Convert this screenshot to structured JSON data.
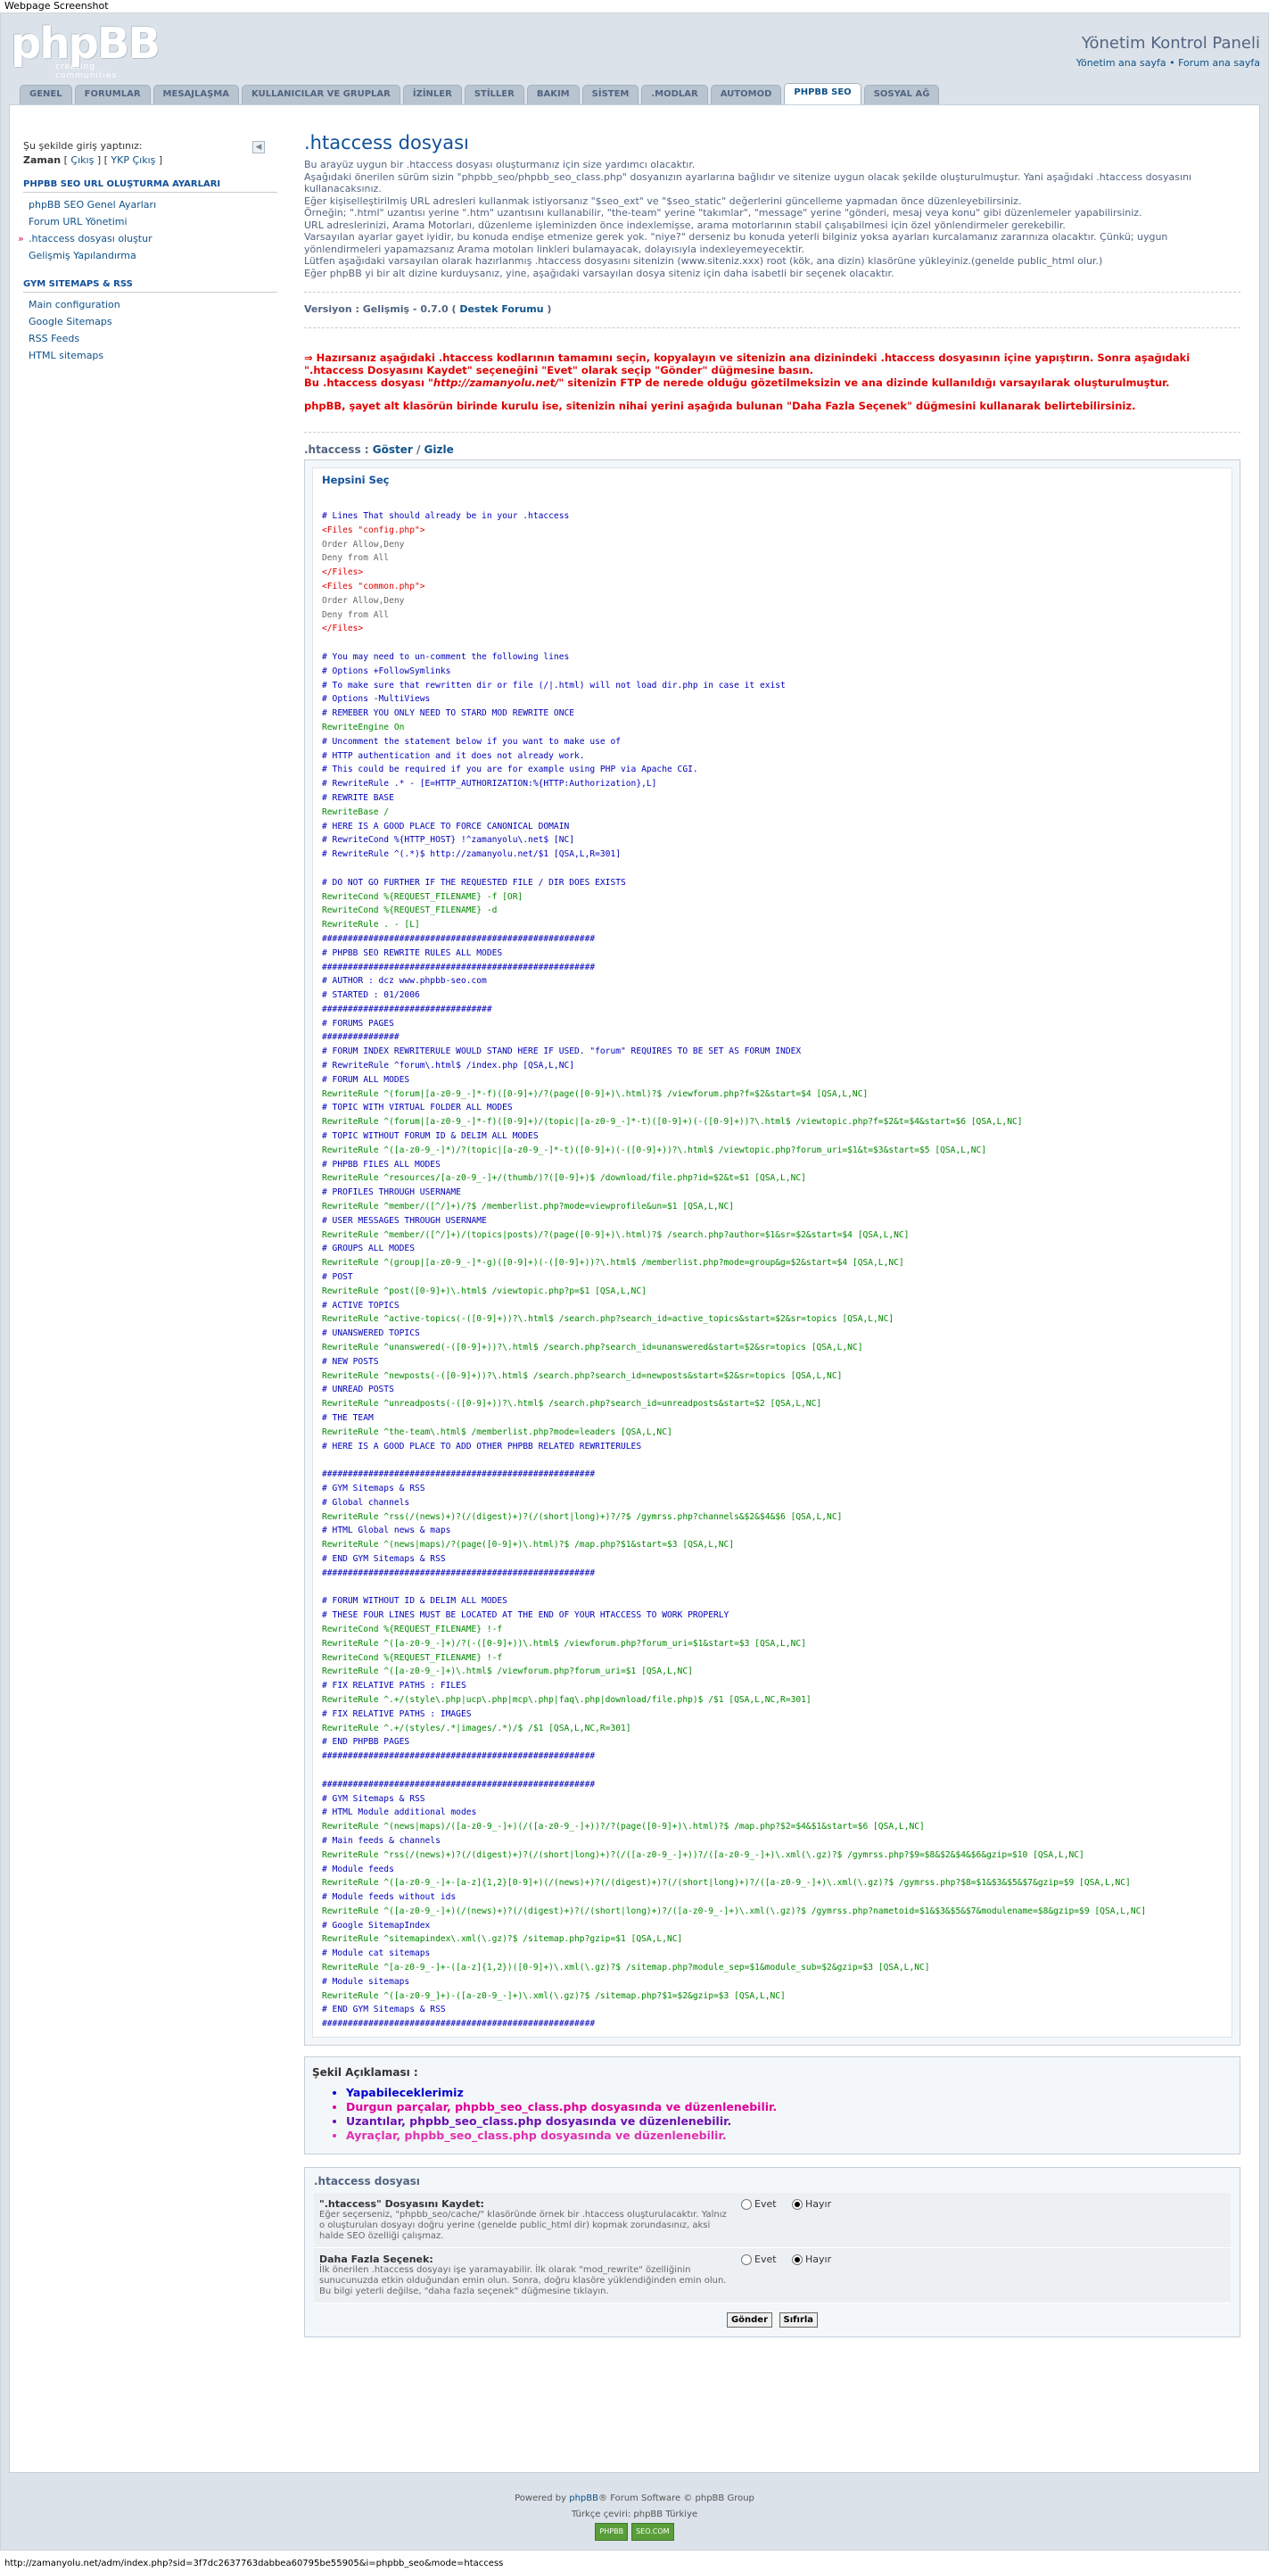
{
  "screenshot_label": "Webpage Screenshot",
  "header": {
    "logo": "phpBB",
    "tagline": "creating communities",
    "title": "Yönetim Kontrol Paneli",
    "link_home": "Yönetim ana sayfa",
    "sep": "•",
    "link_forum": "Forum ana sayfa"
  },
  "tabs": [
    "GENEL",
    "FORUMLAR",
    "MESAJLAŞMA",
    "KULLANICILAR VE GRUPLAR",
    "İZİNLER",
    "STİLLER",
    "BAKIM",
    "SİSTEM",
    ".MODLAR",
    "AUTOMOD",
    "PHPBB SEO",
    "SOSYAL AĞ"
  ],
  "active_tab": 10,
  "sidebar": {
    "login_prefix": "Şu şekilde giriş yaptınız:",
    "user": "Zaman",
    "logout": "Çıkış",
    "acp_logout": "YKP Çıkış",
    "collapse_icon": "double-left-arrow",
    "group1_title": "PHPBB SEO URL OLUŞTURMA AYARLARI",
    "group1_items": [
      "phpBB SEO Genel Ayarları",
      "Forum URL Yönetimi",
      ".htaccess dosyası oluştur",
      "Gelişmiş Yapılandırma"
    ],
    "group1_active": 2,
    "group2_title": "GYM SITEMAPS & RSS",
    "group2_items": [
      "Main configuration",
      "Google Sitemaps",
      "RSS Feeds",
      "HTML sitemaps"
    ]
  },
  "main": {
    "title": ".htaccess dosyası",
    "intro": [
      "Bu arayüz uygun bir .htaccess dosyası oluşturmanız için size yardımcı olacaktır.",
      "Aşağıdaki önerilen sürüm sizin \"phpbb_seo/phpbb_seo_class.php\" dosyanızın ayarlarına bağlıdır ve sitenize uygun olacak şekilde oluşturulmuştur. Yani aşağıdaki .htaccess dosyasını kullanacaksınız.",
      "Eğer kişiselleştirilmiş URL adresleri kullanmak istiyorsanız \"$seo_ext\" ve \"$seo_static\" değerlerini güncelleme yapmadan önce düzenleyebilirsiniz.",
      "Örneğin; \".html\" uzantısı yerine \".htm\" uzantısını kullanabilir, \"the-team\" yerine \"takımlar\", \"message\" yerine \"gönderi, mesaj veya konu\" gibi düzenlemeler yapabilirsiniz.",
      "URL adreslerinizi, Arama Motorları, düzenleme işleminizden önce indexlemişse, arama motorlarının stabil çalışabilmesi için özel yönlendirmeler gerekebilir.",
      "Varsayılan ayarlar gayet iyidir, bu konuda endişe etmenize gerek yok. \"niye?\" derseniz bu konuda yeterli bilginiz yoksa ayarları kurcalamanız zararınıza olacaktır. Çünkü; uygun yönlendirmeleri yapamazsanız Arama motoları linkleri bulamayacak, dolayısıyla indexleyemeyecektir.",
      "Lütfen aşağıdaki varsayılan olarak hazırlanmış .htaccess dosyasını sitenizin (www.siteniz.xxx) root (kök, ana dizin) klasörüne yükleyiniz.(genelde public_html olur.)",
      "Eğer phpBB yi bir alt dizine kurduysanız, yine, aşağıdaki varsayılan dosya siteniz için daha isabetli bir seçenek olacaktır."
    ],
    "version_label": "Versiyon : Gelişmiş - 0.7.0 (",
    "version_link": "Destek Forumu",
    "version_end": ")",
    "warn1": "⇒ Hazırsanız aşağıdaki .htaccess kodlarının tamamını seçin, kopyalayın ve sitenizin ana dizinindeki .htaccess dosyasının içine yapıştırın. Sonra aşağıdaki \".htaccess Dosyasını Kaydet\" seçeneğini \"Evet\" olarak seçip \"Gönder\" düğmesine basın.",
    "warn2_a": "Bu .htaccess dosyası \"",
    "warn2_url": "http://zamanyolu.net/",
    "warn2_b": "\" sitenizin FTP de nerede olduğu gözetilmeksizin ve ana dizinde kullanıldığı varsayılarak oluşturulmuştur.",
    "warn3": "phpBB, şayet alt klasörün birinde kurulu ise, sitenizin nihai yerini aşağıda bulunan \"Daha Fazla Seçenek\" düğmesini kullanarak belirtebilirsiniz.",
    "ht_label": ".htaccess :",
    "ht_show": "Göster",
    "ht_slash": "/",
    "ht_hide": "Gizle",
    "select_all": "Hepsini Seç",
    "code_lines": [
      [
        "c",
        "# Lines That should already be in your .htaccess"
      ],
      [
        "t",
        "<Files \"config.php\">"
      ],
      [
        "g",
        "Order Allow,Deny"
      ],
      [
        "g",
        "Deny from All"
      ],
      [
        "t",
        "</Files>"
      ],
      [
        "t",
        "<Files \"common.php\">"
      ],
      [
        "g",
        "Order Allow,Deny"
      ],
      [
        "g",
        "Deny from All"
      ],
      [
        "t",
        "</Files>"
      ],
      [
        "b",
        ""
      ],
      [
        "c",
        "# You may need to un-comment the following lines"
      ],
      [
        "c",
        "# Options +FollowSymlinks"
      ],
      [
        "c",
        "# To make sure that rewritten dir or file (/|.html) will not load dir.php in case it exist"
      ],
      [
        "c",
        "# Options -MultiViews"
      ],
      [
        "c",
        "# REMEBER YOU ONLY NEED TO STARD MOD REWRITE ONCE"
      ],
      [
        "k",
        "RewriteEngine On"
      ],
      [
        "c",
        "# Uncomment the statement below if you want to make use of"
      ],
      [
        "c",
        "# HTTP authentication and it does not already work."
      ],
      [
        "c",
        "# This could be required if you are for example using PHP via Apache CGI."
      ],
      [
        "c",
        "# RewriteRule .* - [E=HTTP_AUTHORIZATION:%{HTTP:Authorization},L]"
      ],
      [
        "c",
        "# REWRITE BASE"
      ],
      [
        "k",
        "RewriteBase /"
      ],
      [
        "c",
        "# HERE IS A GOOD PLACE TO FORCE CANONICAL DOMAIN"
      ],
      [
        "c",
        "# RewriteCond %{HTTP_HOST} !^zamanyolu\\.net$ [NC]"
      ],
      [
        "c",
        "# RewriteRule ^(.*)$ http://zamanyolu.net/$1 [QSA,L,R=301]"
      ],
      [
        "b",
        ""
      ],
      [
        "c",
        "# DO NOT GO FURTHER IF THE REQUESTED FILE / DIR DOES EXISTS"
      ],
      [
        "k",
        "RewriteCond %{REQUEST_FILENAME} -f [OR]"
      ],
      [
        "k",
        "RewriteCond %{REQUEST_FILENAME} -d"
      ],
      [
        "k",
        "RewriteRule . - [L]"
      ],
      [
        "c",
        "#####################################################"
      ],
      [
        "c",
        "# PHPBB SEO REWRITE RULES ALL MODES"
      ],
      [
        "c",
        "#####################################################"
      ],
      [
        "c",
        "# AUTHOR : dcz www.phpbb-seo.com"
      ],
      [
        "c",
        "# STARTED : 01/2006"
      ],
      [
        "c",
        "#################################"
      ],
      [
        "c",
        "# FORUMS PAGES"
      ],
      [
        "c",
        "###############"
      ],
      [
        "c",
        "# FORUM INDEX REWRITERULE WOULD STAND HERE IF USED. \"forum\" REQUIRES TO BE SET AS FORUM INDEX"
      ],
      [
        "c",
        "# RewriteRule ^forum\\.html$ /index.php [QSA,L,NC]"
      ],
      [
        "c",
        "# FORUM ALL MODES"
      ],
      [
        "k",
        "RewriteRule ^(forum|[a-z0-9_-]*-f)([0-9]+)/?(page([0-9]+)\\.html)?$ /viewforum.php?f=$2&start=$4 [QSA,L,NC]"
      ],
      [
        "c",
        "# TOPIC WITH VIRTUAL FOLDER ALL MODES"
      ],
      [
        "k",
        "RewriteRule ^(forum|[a-z0-9_-]*-f)([0-9]+)/(topic|[a-z0-9_-]*-t)([0-9]+)(-([0-9]+))?\\.html$ /viewtopic.php?f=$2&t=$4&start=$6 [QSA,L,NC]"
      ],
      [
        "c",
        "# TOPIC WITHOUT FORUM ID & DELIM ALL MODES"
      ],
      [
        "k",
        "RewriteRule ^([a-z0-9_-]*)/?(topic|[a-z0-9_-]*-t)([0-9]+)(-([0-9]+))?\\.html$ /viewtopic.php?forum_uri=$1&t=$3&start=$5 [QSA,L,NC]"
      ],
      [
        "c",
        "# PHPBB FILES ALL MODES"
      ],
      [
        "k",
        "RewriteRule ^resources/[a-z0-9_-]+/(thumb/)?([0-9]+)$ /download/file.php?id=$2&t=$1 [QSA,L,NC]"
      ],
      [
        "c",
        "# PROFILES THROUGH USERNAME"
      ],
      [
        "k",
        "RewriteRule ^member/([^/]+)/?$ /memberlist.php?mode=viewprofile&un=$1 [QSA,L,NC]"
      ],
      [
        "c",
        "# USER MESSAGES THROUGH USERNAME"
      ],
      [
        "k",
        "RewriteRule ^member/([^/]+)/(topics|posts)/?(page([0-9]+)\\.html)?$ /search.php?author=$1&sr=$2&start=$4 [QSA,L,NC]"
      ],
      [
        "c",
        "# GROUPS ALL MODES"
      ],
      [
        "k",
        "RewriteRule ^(group|[a-z0-9_-]*-g)([0-9]+)(-([0-9]+))?\\.html$ /memberlist.php?mode=group&g=$2&start=$4 [QSA,L,NC]"
      ],
      [
        "c",
        "# POST"
      ],
      [
        "k",
        "RewriteRule ^post([0-9]+)\\.html$ /viewtopic.php?p=$1 [QSA,L,NC]"
      ],
      [
        "c",
        "# ACTIVE TOPICS"
      ],
      [
        "k",
        "RewriteRule ^active-topics(-([0-9]+))?\\.html$ /search.php?search_id=active_topics&start=$2&sr=topics [QSA,L,NC]"
      ],
      [
        "c",
        "# UNANSWERED TOPICS"
      ],
      [
        "k",
        "RewriteRule ^unanswered(-([0-9]+))?\\.html$ /search.php?search_id=unanswered&start=$2&sr=topics [QSA,L,NC]"
      ],
      [
        "c",
        "# NEW POSTS"
      ],
      [
        "k",
        "RewriteRule ^newposts(-([0-9]+))?\\.html$ /search.php?search_id=newposts&start=$2&sr=topics [QSA,L,NC]"
      ],
      [
        "c",
        "# UNREAD POSTS"
      ],
      [
        "k",
        "RewriteRule ^unreadposts(-([0-9]+))?\\.html$ /search.php?search_id=unreadposts&start=$2 [QSA,L,NC]"
      ],
      [
        "c",
        "# THE TEAM"
      ],
      [
        "k",
        "RewriteRule ^the-team\\.html$ /memberlist.php?mode=leaders [QSA,L,NC]"
      ],
      [
        "c",
        "# HERE IS A GOOD PLACE TO ADD OTHER PHPBB RELATED REWRITERULES"
      ],
      [
        "b",
        ""
      ],
      [
        "c",
        "#####################################################"
      ],
      [
        "c",
        "# GYM Sitemaps & RSS"
      ],
      [
        "c",
        "# Global channels"
      ],
      [
        "k",
        "RewriteRule ^rss(/(news)+)?(/(digest)+)?(/(short|long)+)?/?$ /gymrss.php?channels&$2&$4&$6 [QSA,L,NC]"
      ],
      [
        "c",
        "# HTML Global news & maps"
      ],
      [
        "k",
        "RewriteRule ^(news|maps)/?(page([0-9]+)\\.html)?$ /map.php?$1&start=$3 [QSA,L,NC]"
      ],
      [
        "c",
        "# END GYM Sitemaps & RSS"
      ],
      [
        "c",
        "#####################################################"
      ],
      [
        "b",
        ""
      ],
      [
        "c",
        "# FORUM WITHOUT ID & DELIM ALL MODES"
      ],
      [
        "c",
        "# THESE FOUR LINES MUST BE LOCATED AT THE END OF YOUR HTACCESS TO WORK PROPERLY"
      ],
      [
        "k",
        "RewriteCond %{REQUEST_FILENAME} !-f"
      ],
      [
        "k",
        "RewriteRule ^([a-z0-9_-]+)/?(-([0-9]+))\\.html$ /viewforum.php?forum_uri=$1&start=$3 [QSA,L,NC]"
      ],
      [
        "k",
        "RewriteCond %{REQUEST_FILENAME} !-f"
      ],
      [
        "k",
        "RewriteRule ^([a-z0-9_-]+)\\.html$ /viewforum.php?forum_uri=$1 [QSA,L,NC]"
      ],
      [
        "c",
        "# FIX RELATIVE PATHS : FILES"
      ],
      [
        "k",
        "RewriteRule ^.+/(style\\.php|ucp\\.php|mcp\\.php|faq\\.php|download/file.php)$ /$1 [QSA,L,NC,R=301]"
      ],
      [
        "c",
        "# FIX RELATIVE PATHS : IMAGES"
      ],
      [
        "k",
        "RewriteRule ^.+/(styles/.*|images/.*)/$ /$1 [QSA,L,NC,R=301]"
      ],
      [
        "c",
        "# END PHPBB PAGES"
      ],
      [
        "c",
        "#####################################################"
      ],
      [
        "b",
        ""
      ],
      [
        "c",
        "#####################################################"
      ],
      [
        "c",
        "# GYM Sitemaps & RSS"
      ],
      [
        "c",
        "# HTML Module additional modes"
      ],
      [
        "k",
        "RewriteRule ^(news|maps)/([a-z0-9_-]+)(/([a-z0-9_-]+))?/?(page([0-9]+)\\.html)?$ /map.php?$2=$4&$1&start=$6 [QSA,L,NC]"
      ],
      [
        "c",
        "# Main feeds & channels"
      ],
      [
        "k",
        "RewriteRule ^rss(/(news)+)?(/(digest)+)?(/(short|long)+)?(/([a-z0-9_-]+))?/([a-z0-9_-]+)\\.xml(\\.gz)?$ /gymrss.php?$9=$8&$2&$4&$6&gzip=$10 [QSA,L,NC]"
      ],
      [
        "c",
        "# Module feeds"
      ],
      [
        "k",
        "RewriteRule ^([a-z0-9_-]+-[a-z]{1,2}[0-9]+)(/(news)+)?(/(digest)+)?(/(short|long)+)?/([a-z0-9_-]+)\\.xml(\\.gz)?$ /gymrss.php?$8=$1&$3&$5&$7&gzip=$9 [QSA,L,NC]"
      ],
      [
        "c",
        "# Module feeds without ids"
      ],
      [
        "k",
        "RewriteRule ^([a-z0-9_-]+)(/(news)+)?(/(digest)+)?(/(short|long)+)?/([a-z0-9_-]+)\\.xml(\\.gz)?$ /gymrss.php?nametoid=$1&$3&$5&$7&modulename=$8&gzip=$9 [QSA,L,NC]"
      ],
      [
        "c",
        "# Google SitemapIndex"
      ],
      [
        "k",
        "RewriteRule ^sitemapindex\\.xml(\\.gz)?$ /sitemap.php?gzip=$1 [QSA,L,NC]"
      ],
      [
        "c",
        "# Module cat sitemaps"
      ],
      [
        "k",
        "RewriteRule ^[a-z0-9_-]+-([a-z]{1,2})([0-9]+)\\.xml(\\.gz)?$ /sitemap.php?module_sep=$1&module_sub=$2&gzip=$3 [QSA,L,NC]"
      ],
      [
        "c",
        "# Module sitemaps"
      ],
      [
        "k",
        "RewriteRule ^([a-z0-9_]+)-([a-z0-9_-]+)\\.xml(\\.gz)?$ /sitemap.php?$1=$2&gzip=$3 [QSA,L,NC]"
      ],
      [
        "c",
        "# END GYM Sitemaps & RSS"
      ],
      [
        "c",
        "#####################################################"
      ]
    ],
    "legend_title": "Şekil Açıklaması :",
    "legend_items": [
      {
        "text": "Yapabileceklerimiz",
        "color": "#0000cc"
      },
      {
        "text": "Durgun parçalar, phpbb_seo_class.php dosyasında ve düzenlenebilir.",
        "color": "#e0009a"
      },
      {
        "text": "Uzantılar, phpbb_seo_class.php dosyasında ve düzenlenebilir.",
        "color": "#6a0fb0"
      },
      {
        "text": "Ayraçlar, phpbb_seo_class.php dosyasında ve düzenlenebilir.",
        "color": "#e030b0"
      }
    ],
    "form_title": ".htaccess dosyası",
    "opt1_title": "\".htaccess\" Dosyasını Kaydet:",
    "opt1_desc": "Eğer seçerseniz, \"phpbb_seo/cache/\" klasöründe örnek bir .htaccess oluşturulacaktır. Yalnız o oluşturulan dosyayı doğru yerine (genelde public_html dir) kopmak zorundasınız, aksi halde SEO özelliği çalışmaz.",
    "opt2_title": "Daha Fazla Seçenek:",
    "opt2_desc": "İlk önerilen .htaccess dosyayı işe yaramayabilir. İlk olarak \"mod_rewrite\" özelliğinin sunucunuzda etkin olduğundan emin olun. Sonra, doğru klasöre yüklendiğinden emin olun. Bu bilgi yeterli değilse, \"daha fazla seçenek\" düğmesine tıklayın.",
    "yes": "Evet",
    "no": "Hayır",
    "submit": "Gönder",
    "reset": "Sıfırla"
  },
  "footer": {
    "powered_a": "Powered by",
    "powered_link": "phpBB",
    "powered_b": "® Forum Software © phpBB Group",
    "translation": "Türkçe çeviri: phpBB Türkiye",
    "badge1": "PHPBB",
    "badge2": "SEO.COM"
  },
  "status_url": "http://zamanyolu.net/adm/index.php?sid=3f7dc2637763dabbea60795be55905&i=phpbb_seo&mode=htaccess"
}
